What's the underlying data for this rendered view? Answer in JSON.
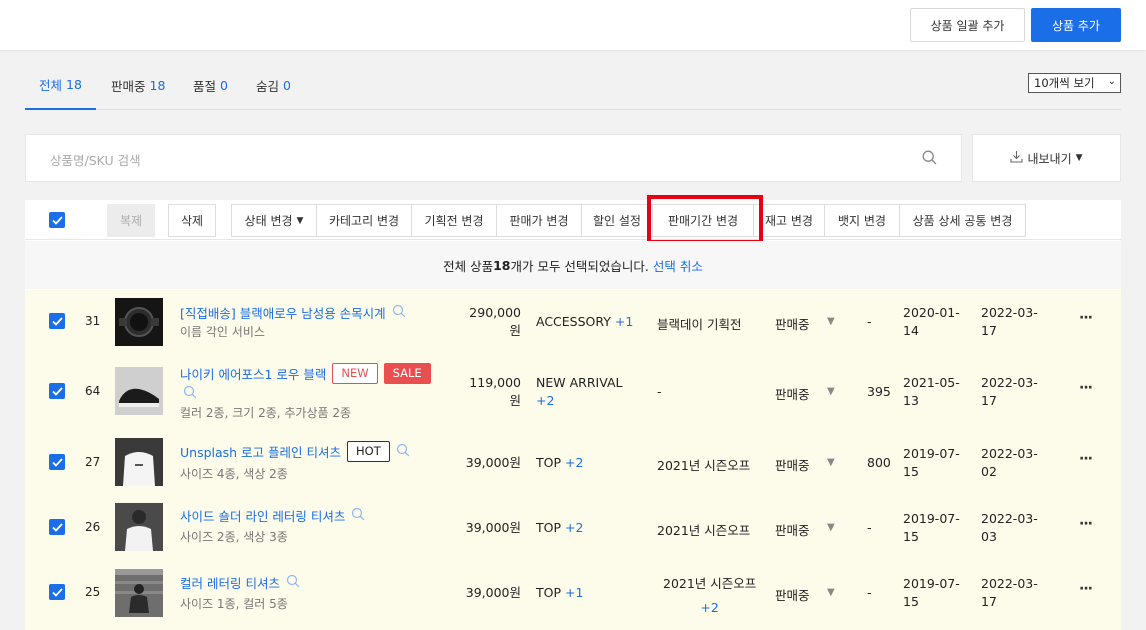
{
  "header": {
    "bulk_add_label": "상품 일괄 추가",
    "add_label": "상품 추가"
  },
  "tabs": [
    {
      "label": "전체",
      "count": "18"
    },
    {
      "label": "판매중",
      "count": "18"
    },
    {
      "label": "품절",
      "count": "0"
    },
    {
      "label": "숨김",
      "count": "0"
    }
  ],
  "per_page": "10개씩 보기",
  "search": {
    "placeholder": "상품명/SKU 검색"
  },
  "export_label": "내보내기",
  "toolbar": {
    "copy": "복제",
    "delete": "삭제",
    "status": "상태 변경",
    "category": "카테고리 변경",
    "promotion": "기획전 변경",
    "price": "판매가 변경",
    "discount": "할인 설정",
    "period": "판매기간 변경",
    "stock": "재고 변경",
    "badge": "뱃지 변경",
    "detail": "상품 상세 공통 변경"
  },
  "notice": {
    "prefix": "전체 상품 ",
    "count": "18",
    "suffix": "개가 모두 선택되었습니다.",
    "cancel": "선택 취소"
  },
  "colors": {
    "accent": "#1a6ee8",
    "highlight": "#e60012",
    "row_bg": "#fdfbe9"
  },
  "rows": [
    {
      "no": "31",
      "name": "[직접배송] 블랙애로우 남성용 손목시계",
      "sub": "이름 각인 서비스",
      "price1": "290,000",
      "price2": "원",
      "cat": "ACCESSORY",
      "cat_plus": "+1",
      "promo": "블랙데이 기획전",
      "status": "판매중",
      "stock": "-",
      "start1": "2020-01-",
      "start2": "14",
      "end1": "2022-03-",
      "end2": "17"
    },
    {
      "no": "64",
      "name": "나이키 에어포스1 로우 블랙",
      "badge1": "NEW",
      "badge2": "SALE",
      "sub": "컬러 2종, 크기 2종, 추가상품 2종",
      "price1": "119,000",
      "price2": "원",
      "cat": "NEW ARRIVAL",
      "cat_plus": "+2",
      "promo": "-",
      "status": "판매중",
      "stock": "395",
      "start1": "2021-05-",
      "start2": "13",
      "end1": "2022-03-",
      "end2": "17"
    },
    {
      "no": "27",
      "name": "Unsplash 로고 플레인 티셔츠",
      "badge1": "HOT",
      "sub": "사이즈 4종, 색상 2종",
      "price1": "39,000원",
      "cat": "TOP",
      "cat_plus": "+2",
      "promo": "2021년 시즌오프",
      "status": "판매중",
      "stock": "800",
      "start1": "2019-07-",
      "start2": "15",
      "end1": "2022-03-",
      "end2": "02"
    },
    {
      "no": "26",
      "name": "사이드 숄더 라인 레터링 티셔츠",
      "sub": "사이즈 2종, 색상 3종",
      "price1": "39,000원",
      "cat": "TOP",
      "cat_plus": "+2",
      "promo": "2021년 시즌오프",
      "status": "판매중",
      "stock": "-",
      "start1": "2019-07-",
      "start2": "15",
      "end1": "2022-03-",
      "end2": "03"
    },
    {
      "no": "25",
      "name": "컬러 레터링 티셔츠",
      "sub": "사이즈 1종, 컬러 5종",
      "price1": "39,000원",
      "cat": "TOP",
      "cat_plus": "+1",
      "promo": "2021년 시즌오프",
      "promo_plus": "+2",
      "status": "판매중",
      "stock": "-",
      "start1": "2019-07-",
      "start2": "15",
      "end1": "2022-03-",
      "end2": "17"
    }
  ]
}
